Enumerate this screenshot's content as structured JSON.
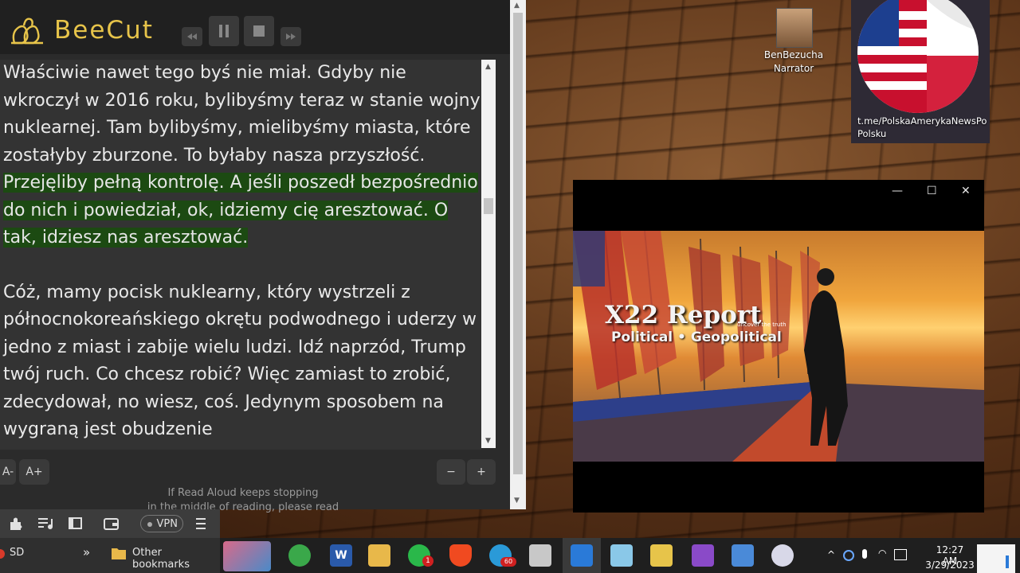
{
  "app": {
    "title": "BeeCut",
    "brand_color": "#e7c44a"
  },
  "reader": {
    "paragraph1_plain": "Właściwie nawet tego byś nie miał. Gdyby nie wkroczył w 2016 roku, bylibyśmy teraz w stanie wojny nuklearnej. Tam bylibyśmy, mielibyśmy miasta, które zostałyby zburzone. To byłaby nasza przyszłość. ",
    "paragraph1_highlight": "Przejęliby pełną kontrolę. A jeśli poszedł bezpośrednio do nich i powiedział, ok, idziemy cię aresztować. O tak, idziesz nas aresztować.",
    "paragraph2": "Cóż, mamy pocisk nuklearny, który wystrzeli z północnokoreańskiego okrętu podwodnego i uderzy w jedno z miast i zabije wielu ludzi. Idź naprzód, Trump twój ruch. Co chcesz robić? Więc zamiast to zrobić, zdecydował, no wiesz, coś. Jedynym sposobem na wygraną jest obudzenie",
    "highlight_color": "#1c4a12",
    "font_decrease": "A-",
    "font_increase": "A+",
    "speed_minus": "−",
    "speed_plus": "+",
    "notice_line1": "If Read Aloud keeps stopping",
    "notice_line2": "in the middle of reading, please read"
  },
  "browser": {
    "vpn_label": "VPN",
    "bookmark_sd": "SD",
    "more_label": "»",
    "other_bookmarks": "Other bookmarks"
  },
  "desktop": {
    "narrator_label_1": "BenBezucha",
    "narrator_label_2": "Narrator",
    "channel_label_1": "t.me/PolskaAmerykaNewsPo",
    "channel_label_2": "Polsku"
  },
  "video": {
    "title": "X22 Report",
    "tagline": "Political • Geopolitical",
    "small_tag": "uncover the truth",
    "minimize": "—",
    "maximize": "☐",
    "close": "✕"
  },
  "taskbar": {
    "time": "12:27 AM",
    "date": "3/29/2023",
    "whatsapp_badge": "1",
    "telegram_badge": "60"
  }
}
